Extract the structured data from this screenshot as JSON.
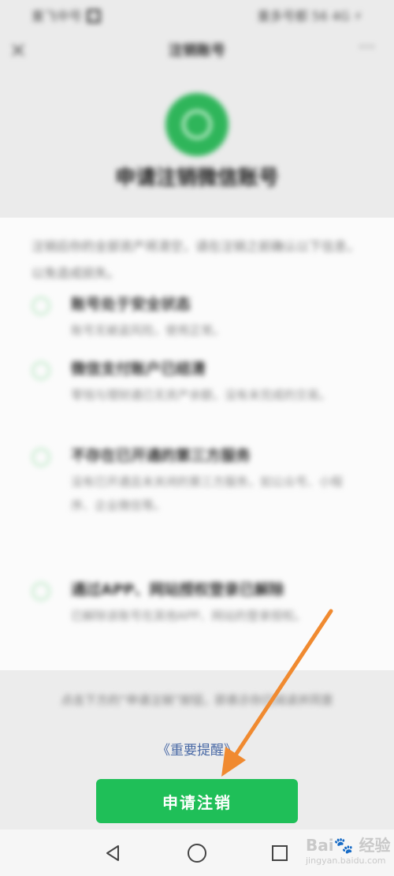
{
  "status_bar": {
    "left": "重飞中号 🔲",
    "right": "重多号都 56 4G ⚡"
  },
  "nav": {
    "close_icon": "close-icon",
    "title": "注销账号",
    "more_label": "···"
  },
  "page": {
    "title": "申请注销微信账号"
  },
  "intro": "注销后你的全部资产将清空，请在注销之前确认以下信息，以免造成损失。",
  "items": [
    {
      "title": "账号处于安全状态",
      "desc": "账号无被盗风险，使用正常。"
    },
    {
      "title": "微信支付账户已结清",
      "desc": "零钱与理财通已无资产余额，没有未完成的交易。"
    },
    {
      "title": "不存在已开通的第三方服务",
      "desc": "没有已开通且未关闭的第三方服务，如公众号、小程序、企业微信等。"
    },
    {
      "title": "通过APP、网站授权登录已解除",
      "desc": "已解除该账号在其他APP、网站的登录授权。"
    }
  ],
  "footer": {
    "note_prefix": "点击下方的“申请注销”按钮，即表示你已阅读并同意",
    "link": "《重要提醒》"
  },
  "button": {
    "label": "申请注销"
  },
  "colors": {
    "accent": "#1fbf58",
    "arrow": "#f08a30"
  },
  "watermark": {
    "text": "Bai🐾 经验",
    "sub": "jingyan.baidu.com"
  }
}
